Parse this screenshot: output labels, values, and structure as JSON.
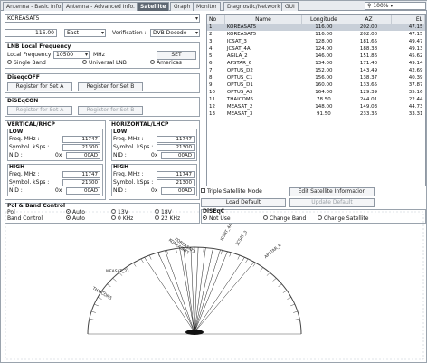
{
  "tabs": [
    {
      "label": "Antenna - Basic Info."
    },
    {
      "label": "Antenna - Advanced Info."
    },
    {
      "label": "Satellite"
    },
    {
      "label": "Graph"
    },
    {
      "label": "Monitor"
    },
    {
      "label": "Diagnostic/Network"
    },
    {
      "label": "GUI"
    }
  ],
  "zoom": "100%",
  "satellite_name": "KOREASAT5",
  "longitude": {
    "value": "116.00",
    "direction": "East"
  },
  "verification": {
    "label": "Verification :",
    "value": "DVB Decode"
  },
  "lnb": {
    "title": "LNB Local Frequency",
    "freq_label": "Local Frequency :",
    "freq_value": "10500",
    "unit": "MHz",
    "set_label": "SET",
    "options": [
      "Single Band",
      "Universal LNB",
      "Americas"
    ]
  },
  "diseqc_off": {
    "title": "DiseqcOFF",
    "btn_a": "Register for Set A",
    "btn_b": "Register for Set B"
  },
  "diseqc_on": {
    "title": "DiSEqCON",
    "btn_a": "Register for Set A",
    "btn_b": "Register for Set B"
  },
  "vertical": {
    "title": "VERTICAL/RHCP",
    "low": {
      "title": "LOW",
      "freq_label": "Freq. MHz :",
      "freq": "11747",
      "sym_label": "Symbol. kSps :",
      "sym": "21300",
      "nid_label": "NID :",
      "nid_hex": "0x",
      "nid": "00AD"
    },
    "high": {
      "title": "HIGH",
      "freq_label": "Freq. MHz :",
      "freq": "11747",
      "sym_label": "Symbol. kSps :",
      "sym": "21300",
      "nid_label": "NID :",
      "nid_hex": "0x",
      "nid": "00AD"
    }
  },
  "horizontal": {
    "title": "HORIZONTAL/LHCP",
    "low": {
      "title": "LOW",
      "freq_label": "Freq. MHz :",
      "freq": "11747",
      "sym_label": "Symbol. kSps :",
      "sym": "21300",
      "nid_label": "NID :",
      "nid_hex": "0x",
      "nid": "00AD"
    },
    "high": {
      "title": "HIGH",
      "freq_label": "Freq. MHz :",
      "freq": "11747",
      "sym_label": "Symbol. kSps :",
      "sym": "21300",
      "nid_label": "NID :",
      "nid_hex": "0x",
      "nid": "00AD"
    }
  },
  "pol_band": {
    "title": "Pol & Band Control",
    "pol_label": "Pol",
    "band_label": "Band Control",
    "pol_options": [
      "Auto",
      "13V",
      "18V"
    ],
    "band_options": [
      "Auto",
      "0 KHz",
      "22 KHz"
    ]
  },
  "table": {
    "headers": [
      "No",
      "Name",
      "Longitude",
      "AZ",
      "EL"
    ],
    "rows": [
      [
        "1",
        "KOREASAT5",
        "116.00",
        "202.00",
        "47.15"
      ],
      [
        "2",
        "KOREASAT5",
        "116.00",
        "202.00",
        "47.15"
      ],
      [
        "3",
        "JCSAT_3",
        "128.00",
        "181.65",
        "49.47"
      ],
      [
        "4",
        "JCSAT_4A",
        "124.00",
        "188.38",
        "49.13"
      ],
      [
        "5",
        "AGILA_2",
        "146.00",
        "151.86",
        "45.62"
      ],
      [
        "6",
        "APSTAR_6",
        "134.00",
        "171.40",
        "49.14"
      ],
      [
        "7",
        "OPTUS_D2",
        "152.00",
        "143.49",
        "42.69"
      ],
      [
        "8",
        "OPTUS_C1",
        "156.00",
        "138.37",
        "40.39"
      ],
      [
        "9",
        "OPTUS_D1",
        "160.00",
        "133.65",
        "37.87"
      ],
      [
        "10",
        "OPTUS_A3",
        "164.00",
        "129.39",
        "35.16"
      ],
      [
        "11",
        "THAICOM5",
        "78.50",
        "244.01",
        "22.44"
      ],
      [
        "12",
        "MEASAT_2",
        "148.00",
        "149.03",
        "44.73"
      ],
      [
        "13",
        "MEASAT_3",
        "91.50",
        "233.36",
        "33.31"
      ]
    ]
  },
  "triple_mode": "Triple Satellite Mode",
  "edit_btn": "Edit Satellite Information",
  "load_default": "Load Default",
  "update_default": "Update Default",
  "diseqc": {
    "title": "DiSEqC",
    "options": [
      "Not Use",
      "Change Band",
      "Change Satellite"
    ]
  },
  "arc": {
    "labels": [
      "APSTAR_6",
      "JCSAT_3",
      "JCSAT_4A",
      "KOREASAT5",
      "KOREASAT5",
      "MEASAT_2",
      "THAICOM5"
    ],
    "elevation_values": [
      47.15,
      49.47,
      49.13,
      45.62,
      49.14,
      42.69,
      40.39,
      37.87,
      35.16,
      22.44,
      44.73,
      33.31
    ]
  }
}
